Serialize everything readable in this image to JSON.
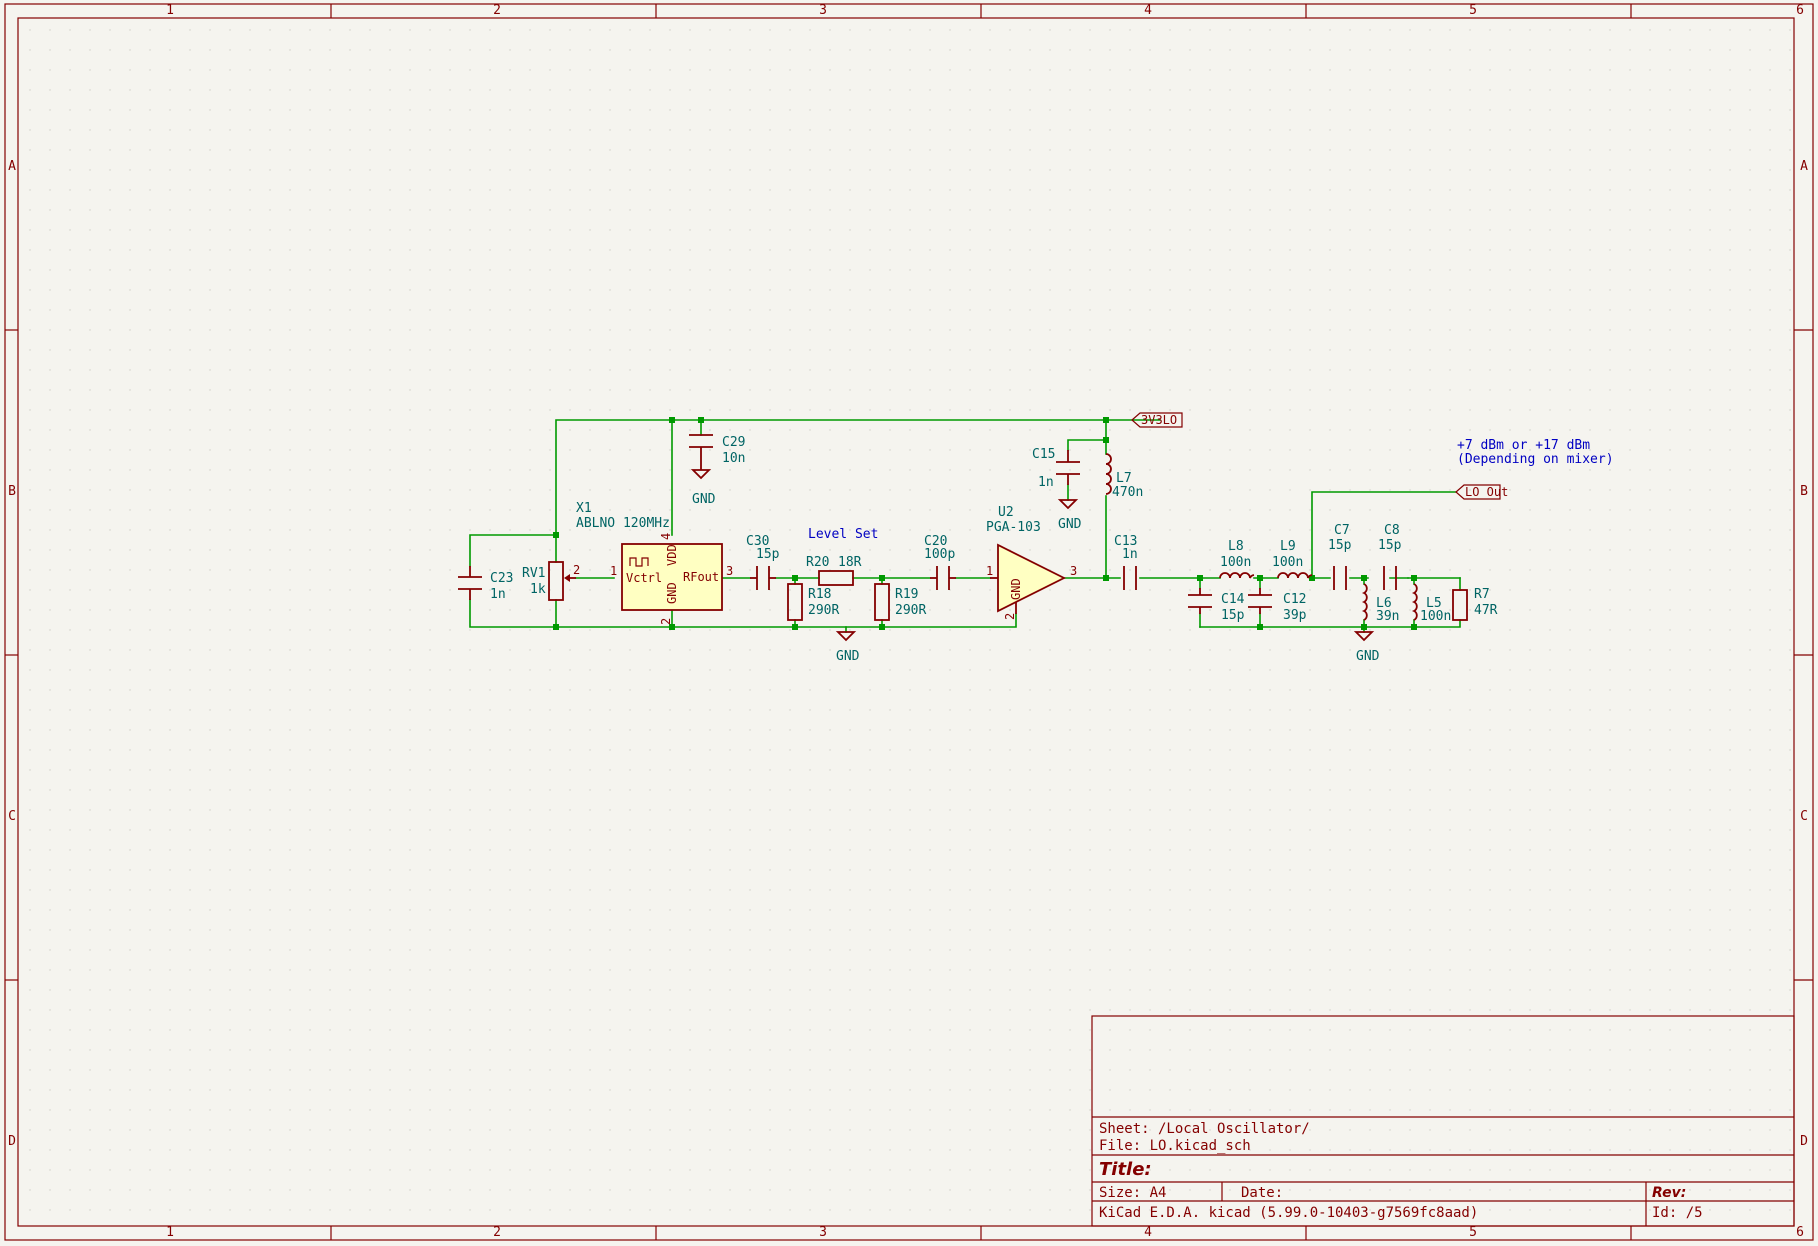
{
  "grid": {
    "columns": [
      "1",
      "2",
      "3",
      "4",
      "5",
      "6"
    ],
    "rows": [
      "A",
      "B",
      "C",
      "D"
    ]
  },
  "components": {
    "x1": {
      "ref": "X1",
      "value": "ABLNO 120MHz",
      "pin_vctrl": "Vctrl",
      "pin_rfout": "RFout",
      "pin_vdd": "VDD",
      "pin_gnd": "GND",
      "pin1": "1",
      "pin2": "2",
      "pin3": "3",
      "pin4": "4"
    },
    "rv1": {
      "ref": "RV1",
      "value": "1k",
      "pin2": "2"
    },
    "c23": {
      "ref": "C23",
      "value": "1n"
    },
    "c29": {
      "ref": "C29",
      "value": "10n"
    },
    "c30": {
      "ref": "C30",
      "value": "15p"
    },
    "r20": {
      "ref": "R20",
      "value": "18R"
    },
    "r18": {
      "ref": "R18",
      "value": "290R"
    },
    "r19": {
      "ref": "R19",
      "value": "290R"
    },
    "c20": {
      "ref": "C20",
      "value": "100p"
    },
    "u2": {
      "ref": "U2",
      "value": "PGA-103",
      "pin_gnd": "GND",
      "pin1": "1",
      "pin2": "2",
      "pin3": "3"
    },
    "c15": {
      "ref": "C15",
      "value": "1n"
    },
    "l7": {
      "ref": "L7",
      "value": "470n"
    },
    "c13": {
      "ref": "C13",
      "value": "1n"
    },
    "l8": {
      "ref": "L8",
      "value": "100n"
    },
    "l9": {
      "ref": "L9",
      "value": "100n"
    },
    "c14": {
      "ref": "C14",
      "value": "15p"
    },
    "c12": {
      "ref": "C12",
      "value": "39p"
    },
    "c7": {
      "ref": "C7",
      "value": "15p"
    },
    "c8": {
      "ref": "C8",
      "value": "15p"
    },
    "l6": {
      "ref": "L6",
      "value": "39n"
    },
    "l5": {
      "ref": "L5",
      "value": "100n"
    },
    "r7": {
      "ref": "R7",
      "value": "47R"
    }
  },
  "gnd_label": "GND",
  "net_labels": {
    "supply": "3V3LO",
    "output": "LO_Out"
  },
  "notes": {
    "level_set": "Level Set",
    "power_line1": "+7 dBm or +17 dBm",
    "power_line2": "(Depending on mixer)"
  },
  "title_block": {
    "sheet": "Sheet: /Local Oscillator/",
    "file": "File: LO.kicad_sch",
    "title": "Title:",
    "size": "Size: A4",
    "date": "Date:",
    "rev": "Rev:",
    "eda": "KiCad E.D.A.  kicad (5.99.0-10403-g7569fc8aad)",
    "id": "Id:  /5"
  }
}
